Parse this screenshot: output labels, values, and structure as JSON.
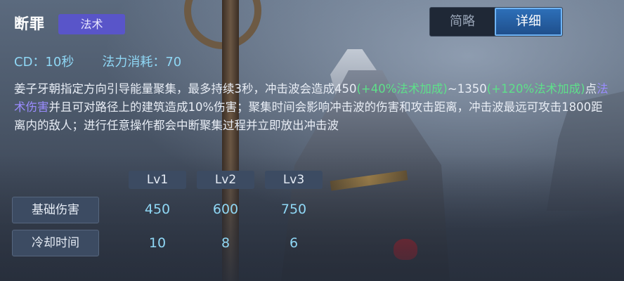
{
  "skill": {
    "name": "断罪",
    "type_badge": "法术"
  },
  "tabs": {
    "brief_label": "简略",
    "detail_label": "详细",
    "active": "详细"
  },
  "stats": {
    "cooldown": "CD：10秒",
    "mana_cost": "法力消耗：70"
  },
  "description": {
    "part1": "姜子牙朝指定方向引导能量聚集，最多持续3秒，冲击波会造成450",
    "bonus1": "(+40%法术加成)",
    "part2": "~1350",
    "bonus2": "(+120%法术加成)",
    "part3": "点",
    "damage_type": "法术伤害",
    "part4": "并且可对路径上的建筑造成10%伤害；聚集时间会影响冲击波的伤害和攻击距离，冲击波最远可攻击1800距离内的敌人；进行任意操作都会中断聚集过程并立即放出冲击波"
  },
  "level_table": {
    "levels": [
      "Lv1",
      "Lv2",
      "Lv3"
    ],
    "rows": [
      {
        "label": "基础伤害",
        "values": [
          "450",
          "600",
          "750"
        ]
      },
      {
        "label": "冷却时间",
        "values": [
          "10",
          "8",
          "6"
        ]
      }
    ]
  },
  "colors": {
    "badge": "#5955c9",
    "stat_text": "#8fd7f5",
    "bonus_green": "#5ee08a",
    "magic_purple": "#9a8cff",
    "active_tab": "#2d6fb8"
  }
}
